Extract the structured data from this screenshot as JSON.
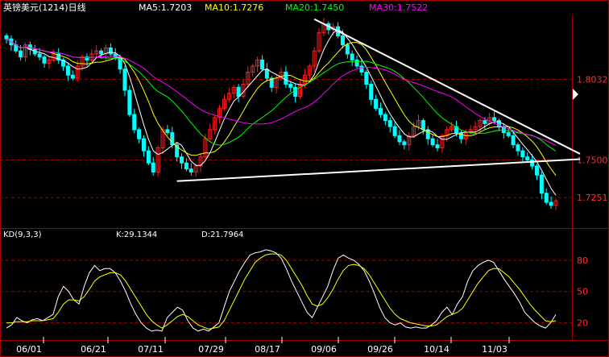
{
  "chart_data": [
    {
      "type": "candlestick",
      "title": "英镑美元(1214)日线",
      "indicators": [
        {
          "label": "MA5:1.7203",
          "color": "#ffffff"
        },
        {
          "label": "MA10:1.7276",
          "color": "#ffff00"
        },
        {
          "label": "MA20:1.7450",
          "color": "#00ff00"
        },
        {
          "label": "MA30:1.7522",
          "color": "#ff00ff"
        }
      ],
      "y_tick_labels": [
        "1.7251",
        "1.8032",
        "1.7500"
      ],
      "ylim": [
        1.705,
        1.845
      ],
      "x_tick_labels": [
        "06/01",
        "06/21",
        "07/11",
        "07/29",
        "08/17",
        "09/06",
        "09/26",
        "10/14",
        "11/03"
      ],
      "colors": {
        "up": "#ff2020",
        "down": "#00ffff",
        "ma5": "#ffffff",
        "ma10": "#ffff00",
        "ma20": "#00ff00",
        "ma30": "#ff00ff",
        "trendline": "#ffffff",
        "grid": "#a00000"
      },
      "closes": [
        1.83,
        1.826,
        1.822,
        1.818,
        1.826,
        1.823,
        1.82,
        1.818,
        1.814,
        1.816,
        1.82,
        1.816,
        1.812,
        1.806,
        1.804,
        1.812,
        1.818,
        1.816,
        1.82,
        1.822,
        1.82,
        1.824,
        1.82,
        1.818,
        1.81,
        1.796,
        1.78,
        1.77,
        1.764,
        1.756,
        1.748,
        1.742,
        1.758,
        1.77,
        1.768,
        1.76,
        1.752,
        1.748,
        1.744,
        1.742,
        1.746,
        1.752,
        1.764,
        1.77,
        1.778,
        1.784,
        1.79,
        1.794,
        1.798,
        1.792,
        1.8,
        1.808,
        1.812,
        1.816,
        1.81,
        1.804,
        1.798,
        1.804,
        1.808,
        1.8,
        1.798,
        1.792,
        1.8,
        1.806,
        1.812,
        1.822,
        1.834,
        1.84,
        1.836,
        1.838,
        1.832,
        1.826,
        1.82,
        1.816,
        1.812,
        1.808,
        1.8,
        1.79,
        1.784,
        1.78,
        1.776,
        1.772,
        1.766,
        1.762,
        1.76,
        1.766,
        1.772,
        1.776,
        1.77,
        1.764,
        1.76,
        1.758,
        1.766,
        1.77,
        1.772,
        1.768,
        1.764,
        1.768,
        1.77,
        1.772,
        1.776,
        1.774,
        1.778,
        1.776,
        1.772,
        1.768,
        1.766,
        1.76,
        1.756,
        1.752,
        1.75,
        1.746,
        1.74,
        1.728,
        1.722,
        1.72,
        1.723
      ],
      "trendlines": [
        {
          "from": {
            "index": 65,
            "value": 1.843
          },
          "to": {
            "index": 116,
            "value": 1.754
          }
        },
        {
          "from": {
            "index": 36,
            "value": 1.736
          },
          "to": {
            "index": 116,
            "value": 1.7505
          }
        }
      ]
    },
    {
      "type": "line",
      "title": "KD(9,3,3)",
      "series": [
        {
          "name": "K:29.1344",
          "color": "#ffffff",
          "values": [
            15,
            18,
            25,
            22,
            20,
            23,
            24,
            22,
            25,
            28,
            45,
            55,
            50,
            42,
            38,
            55,
            68,
            75,
            70,
            72,
            72,
            68,
            60,
            50,
            38,
            28,
            20,
            15,
            12,
            13,
            12,
            25,
            30,
            35,
            32,
            22,
            15,
            12,
            14,
            12,
            16,
            20,
            35,
            50,
            60,
            70,
            78,
            85,
            87,
            88,
            90,
            89,
            87,
            82,
            72,
            60,
            50,
            40,
            30,
            25,
            35,
            45,
            55,
            70,
            82,
            85,
            82,
            80,
            76,
            70,
            60,
            48,
            35,
            25,
            20,
            18,
            20,
            16,
            15,
            16,
            15,
            15,
            18,
            22,
            30,
            35,
            28,
            38,
            45,
            60,
            70,
            75,
            78,
            80,
            78,
            70,
            62,
            55,
            48,
            40,
            30,
            25,
            20,
            17,
            15,
            20,
            28
          ]
        },
        {
          "name": "D:21.7964",
          "color": "#ffff00",
          "values": [
            20,
            20,
            21,
            21,
            21,
            22,
            22,
            22,
            23,
            24,
            30,
            38,
            42,
            42,
            41,
            45,
            52,
            60,
            64,
            66,
            68,
            68,
            66,
            60,
            52,
            44,
            36,
            28,
            22,
            18,
            15,
            18,
            22,
            26,
            28,
            26,
            22,
            18,
            16,
            14,
            15,
            16,
            22,
            32,
            42,
            52,
            62,
            70,
            78,
            82,
            85,
            86,
            86,
            85,
            80,
            72,
            64,
            56,
            46,
            38,
            36,
            38,
            44,
            52,
            62,
            70,
            75,
            76,
            75,
            72,
            66,
            58,
            50,
            42,
            34,
            28,
            24,
            22,
            20,
            19,
            18,
            17,
            17,
            18,
            22,
            26,
            28,
            30,
            34,
            42,
            50,
            58,
            64,
            70,
            72,
            72,
            68,
            64,
            58,
            52,
            45,
            38,
            32,
            27,
            22,
            21,
            22
          ]
        }
      ],
      "y_tick_labels": [
        "80",
        "50",
        "20"
      ],
      "ylim": [
        5,
        100
      ]
    }
  ]
}
